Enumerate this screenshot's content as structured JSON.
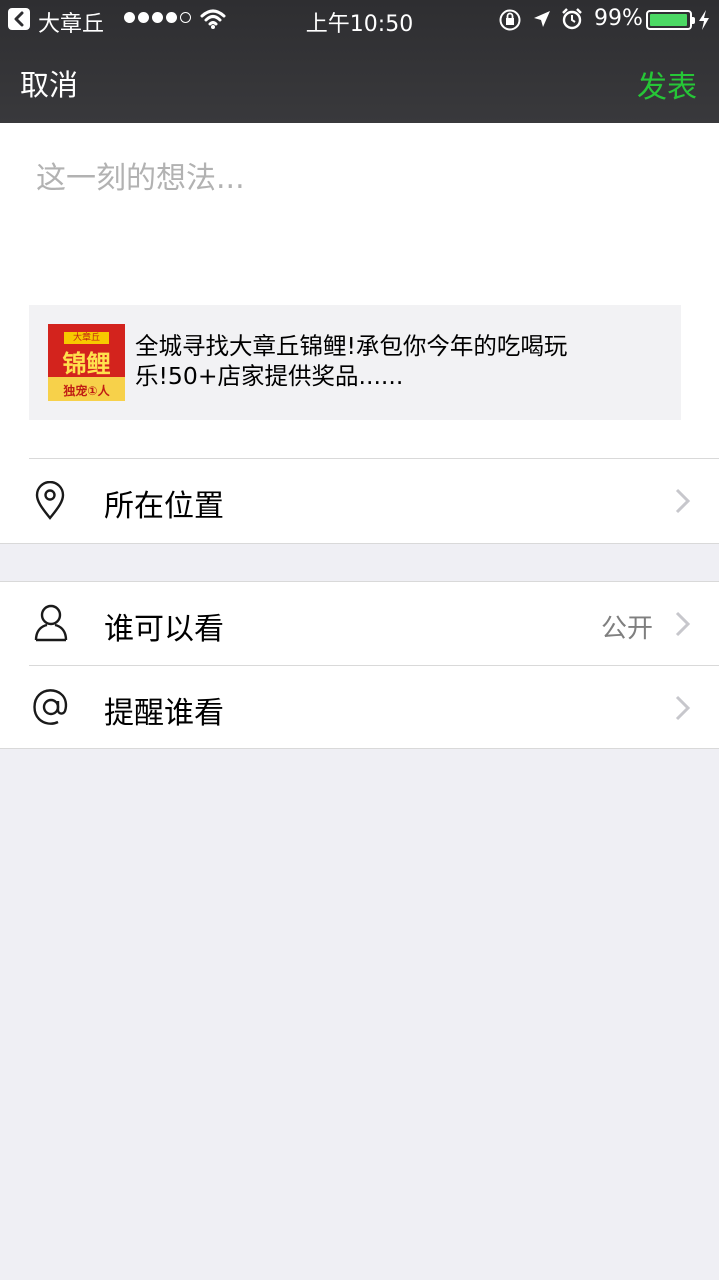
{
  "status_bar": {
    "back_app": "大章丘",
    "time": "上午10:50",
    "battery_percent": "99%",
    "battery_level": 0.99,
    "signal_bars_filled": 4,
    "signal_bars_total": 5,
    "icons": [
      "back-arrow-icon",
      "wifi-icon",
      "rotation-lock-icon",
      "location-arrow-icon",
      "alarm-icon",
      "battery-icon",
      "charging-bolt-icon"
    ]
  },
  "nav": {
    "cancel_label": "取消",
    "publish_label": "发表",
    "publish_color": "#26c637"
  },
  "compose": {
    "placeholder": "这一刻的想法...",
    "value": ""
  },
  "share_card": {
    "title": "全城寻找大章丘锦鲤!承包你今年的吃喝玩乐!50+店家提供奖品......",
    "thumb": {
      "top_tag": "大章丘",
      "main_word": "锦鲤",
      "bottom_text": "独宠①人"
    }
  },
  "options": {
    "location": {
      "label": "所在位置",
      "icon": "location-pin-icon"
    },
    "visibility": {
      "label": "谁可以看",
      "value": "公开",
      "icon": "person-icon"
    },
    "mention": {
      "label": "提醒谁看",
      "icon": "at-sign-icon"
    }
  }
}
